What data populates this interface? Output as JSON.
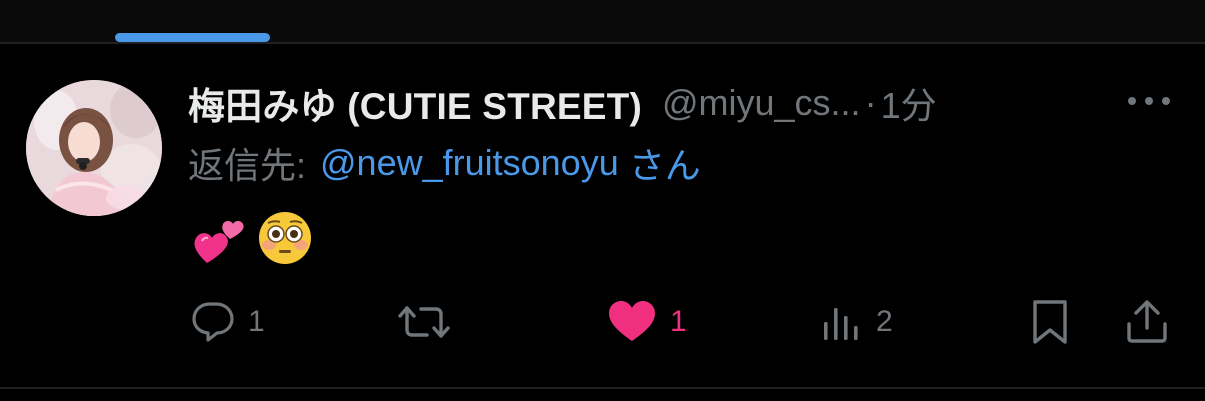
{
  "tabs": {
    "active_indicator_color": "#4a99e9"
  },
  "tweet": {
    "author": {
      "display_name": "梅田みゆ (CUTIE STREET)",
      "handle": "@miyu_cs...",
      "avatar_icon": "profile-photo"
    },
    "separator": "·",
    "time": "1分",
    "more_icon": "more-horizontal-icon",
    "reply": {
      "prefix": "返信先:",
      "handle": "@new_fruitsonoyu",
      "suffix": "さん"
    },
    "body": {
      "emojis": [
        "two-hearts-emoji",
        "flushed-face-emoji"
      ]
    },
    "actions": {
      "reply": {
        "icon": "reply-icon",
        "count": "1"
      },
      "retweet": {
        "icon": "retweet-icon"
      },
      "like": {
        "icon": "heart-icon",
        "count": "1",
        "liked": true,
        "color": "#f0307f"
      },
      "views": {
        "icon": "views-icon",
        "count": "2"
      },
      "bookmark": {
        "icon": "bookmark-icon"
      },
      "share": {
        "icon": "share-icon"
      }
    }
  },
  "colors": {
    "background": "#000000",
    "text_primary": "#e7e9ea",
    "text_secondary": "#71767b",
    "link": "#4a99e9",
    "like": "#f0307f"
  }
}
